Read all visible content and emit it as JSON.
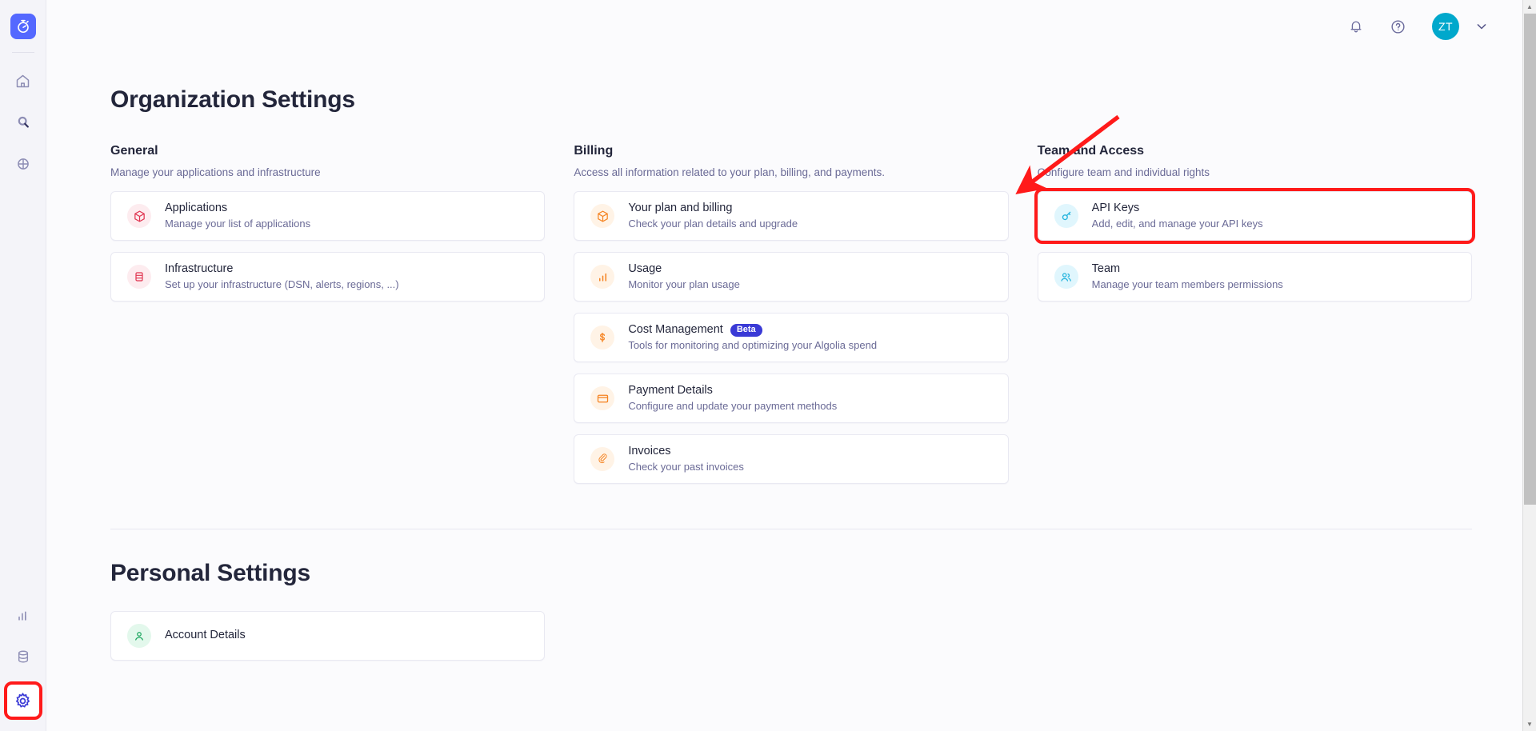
{
  "rail": {
    "logo_name": "algolia-stopwatch-logo",
    "items": [
      {
        "name": "home-icon",
        "label": "Home"
      },
      {
        "name": "search-icon",
        "label": "Search"
      },
      {
        "name": "globe-icon",
        "label": "Discover"
      }
    ],
    "bottom_items": [
      {
        "name": "analytics-icon",
        "label": "Analytics"
      },
      {
        "name": "database-icon",
        "label": "Data sources"
      },
      {
        "name": "settings-gear-icon",
        "label": "Settings",
        "highlighted": true
      }
    ]
  },
  "topbar": {
    "notifications_label": "Notifications",
    "help_label": "Help",
    "avatar_initials": "ZT",
    "account_menu_label": "Account menu"
  },
  "main": {
    "org_title": "Organization Settings",
    "personal_title": "Personal Settings",
    "columns": [
      {
        "title": "General",
        "subtitle": "Manage your applications and infrastructure",
        "cards": [
          {
            "icon": "package-box-icon",
            "icon_color": "ic-red",
            "title": "Applications",
            "desc": "Manage your list of applications",
            "badge": null,
            "highlighted": false
          },
          {
            "icon": "database-icon",
            "icon_color": "ic-red",
            "title": "Infrastructure",
            "desc": "Set up your infrastructure (DSN, alerts, regions, ...)",
            "badge": null,
            "highlighted": false
          }
        ]
      },
      {
        "title": "Billing",
        "subtitle": "Access all information related to your plan, billing, and payments.",
        "cards": [
          {
            "icon": "package-box-icon",
            "icon_color": "ic-orange",
            "title": "Your plan and billing",
            "desc": "Check your plan details and upgrade",
            "badge": null,
            "highlighted": false
          },
          {
            "icon": "bar-chart-icon",
            "icon_color": "ic-orange",
            "title": "Usage",
            "desc": "Monitor your plan usage",
            "badge": null,
            "highlighted": false
          },
          {
            "icon": "dollar-sign-icon",
            "icon_color": "ic-orange",
            "title": "Cost Management",
            "desc": "Tools for monitoring and optimizing your Algolia spend",
            "badge": "Beta",
            "highlighted": false
          },
          {
            "icon": "credit-card-icon",
            "icon_color": "ic-orange",
            "title": "Payment Details",
            "desc": "Configure and update your payment methods",
            "badge": null,
            "highlighted": false
          },
          {
            "icon": "paperclip-icon",
            "icon_color": "ic-orange",
            "title": "Invoices",
            "desc": "Check your past invoices",
            "badge": null,
            "highlighted": false
          }
        ]
      },
      {
        "title": "Team and Access",
        "subtitle": "Configure team and individual rights",
        "cards": [
          {
            "icon": "key-icon",
            "icon_color": "ic-cyan",
            "title": "API Keys",
            "desc": "Add, edit, and manage your API keys",
            "badge": null,
            "highlighted": true
          },
          {
            "icon": "users-icon",
            "icon_color": "ic-cyan",
            "title": "Team",
            "desc": "Manage your team members permissions",
            "badge": null,
            "highlighted": false
          }
        ]
      }
    ],
    "personal_cards": [
      {
        "icon": "user-circle-icon",
        "icon_color": "ic-green",
        "title": "Account Details",
        "desc": "",
        "badge": null,
        "highlighted": false
      }
    ]
  },
  "annotation": {
    "arrow_color": "#ff1a1a",
    "highlight_color": "#ff1a1a"
  },
  "scrollbar": {
    "up_glyph": "▲",
    "down_glyph": "▼"
  }
}
